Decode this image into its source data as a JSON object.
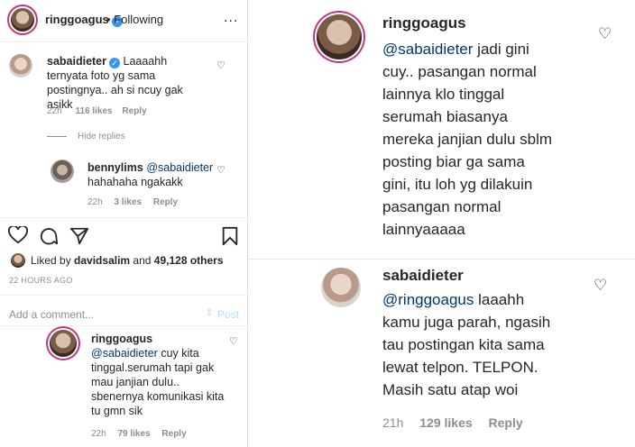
{
  "post_header": {
    "username": "ringgoagus",
    "separator": "•",
    "follow_status": "Following",
    "more_label": "..."
  },
  "comments": [
    {
      "username": "sabaidieter",
      "text": "Laaaahh ternyata foto yg sama postingnya.. ah si ncuy gak asikk",
      "time": "22h",
      "likes": "116 likes",
      "reply": "Reply"
    }
  ],
  "hide_replies": "Hide replies",
  "reply_comment": {
    "username": "bennylims",
    "mention": "@sabaidieter",
    "text": "hahahaha ngakakk",
    "time": "22h",
    "likes": "3 likes",
    "reply": "Reply"
  },
  "likes_summary": {
    "prefix": "Liked by",
    "user": "davidsalim",
    "middle": "and",
    "others": "49,128 others"
  },
  "time_ago": "22 HOURS AGO",
  "add_comment": {
    "placeholder": "Add a comment...",
    "post_label": "Post"
  },
  "bottom_comment": {
    "username": "ringgoagus",
    "mention": "@sabaidieter",
    "text": "cuy kita tinggal.serumah tapi gak mau janjian dulu.. sbenernya komunikasi kita tu gmn sik",
    "time": "22h",
    "likes": "79 likes",
    "reply": "Reply"
  },
  "zoom_top": {
    "username": "ringgoagus",
    "mention": "@sabaidieter",
    "lines": [
      " jadi gini",
      "cuy.. pasangan normal",
      "lainnya klo tinggal",
      "serumah biasanya",
      "mereka janjian dulu sblm",
      "posting biar ga sama",
      "gini, itu loh yg dilakuin",
      "pasangan normal",
      "lainnyaaaaa"
    ]
  },
  "zoom_bottom": {
    "username": "sabaidieter",
    "mention": "@ringgoagus",
    "lines": [
      " laaahh",
      "kamu juga parah, ngasih",
      "tau postingan kita sama",
      "lewat telpon. TELPON.",
      "Masih satu atap woi"
    ],
    "time": "21h",
    "likes": "129 likes",
    "reply": "Reply"
  },
  "colors": {
    "verified": "#3897f0",
    "mention": "#00376b",
    "muted": "#8e8e8e",
    "story_ring": "#c13584"
  }
}
